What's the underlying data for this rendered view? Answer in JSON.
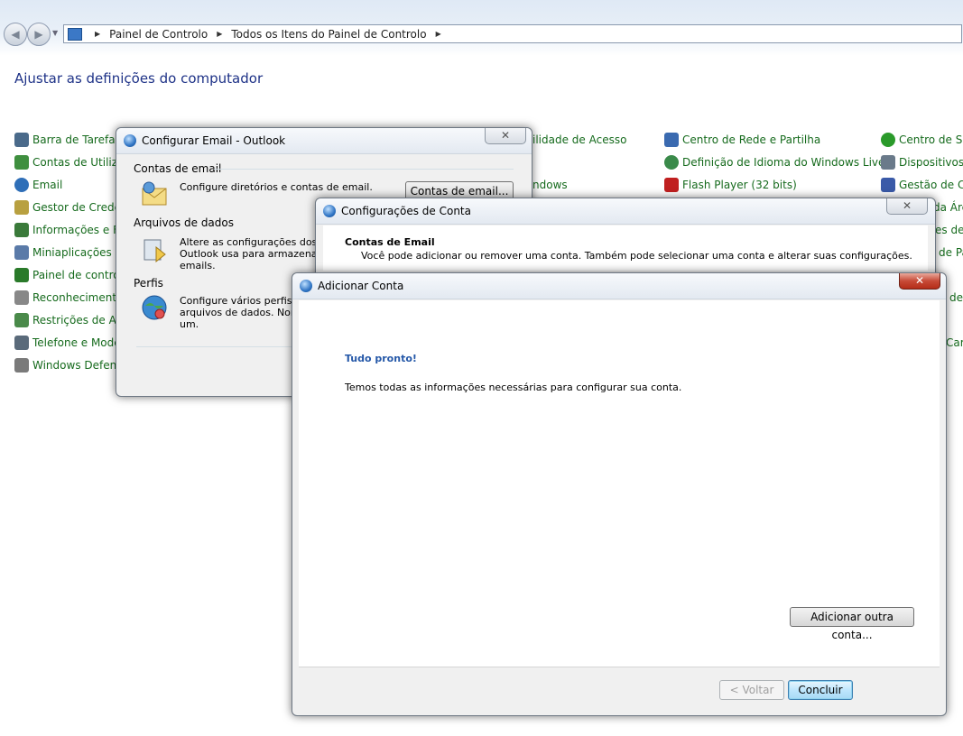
{
  "breadcrumb": [
    "Painel de Controlo",
    "Todos os Itens do Painel de Controlo"
  ],
  "heading": "Ajustar as definições do computador",
  "cp_column1": [
    {
      "label": "Barra de Tarefas e",
      "icon": "taskbar-icon",
      "color": "#4a6a8a"
    },
    {
      "label": "Contas de Utilizad",
      "icon": "users-icon",
      "color": "#3f8f3f"
    },
    {
      "label": "Email",
      "icon": "email-globe-icon",
      "color": "#2f6fb8"
    },
    {
      "label": "Gestor de Creden",
      "icon": "credential-icon",
      "color": "#b8a040"
    },
    {
      "label": "Informações e Fer",
      "icon": "performance-icon",
      "color": "#3a7a3a"
    },
    {
      "label": "Miniaplicações de",
      "icon": "gadgets-icon",
      "color": "#5a7aa8"
    },
    {
      "label": "Painel de controlo",
      "icon": "java-icon",
      "color": "#2a7a2a"
    },
    {
      "label": "Reconhecimento",
      "icon": "microphone-icon",
      "color": "#888888"
    },
    {
      "label": "Restrições de Ace",
      "icon": "parental-icon",
      "color": "#4a8a4a"
    },
    {
      "label": "Telefone e Moder",
      "icon": "phone-icon",
      "color": "#5a6a7a"
    },
    {
      "label": "Windows Defende",
      "icon": "defender-icon",
      "color": "#7a7a7a"
    }
  ],
  "cp_column2": [
    {
      "label": "ilidade de Acesso"
    },
    {
      "label": "ndows"
    }
  ],
  "cp_column3": [
    {
      "label": "Centro de Rede e Partilha",
      "icon": "network-icon",
      "color": "#3a6ab0"
    },
    {
      "label": "Definição de Idioma do Windows Live",
      "icon": "globe-icon",
      "color": "#3a8a4a"
    },
    {
      "label": "Flash Player (32 bits)",
      "icon": "flash-icon",
      "color": "#c02020"
    }
  ],
  "cp_column4": [
    {
      "label": "Centro de Sin",
      "icon": "sync-icon",
      "color": "#2a9a2a"
    },
    {
      "label": "Dispositivos e",
      "icon": "devices-icon",
      "color": "#6a7a8a"
    },
    {
      "label": "Gestão de Co",
      "icon": "color-icon",
      "color": "#3a5aa8"
    },
    {
      "label": "da Áre"
    },
    {
      "label": "es de P"
    },
    {
      "label": "de Pa"
    },
    {
      "label": "de"
    },
    {
      "label": "Car"
    }
  ],
  "outlook_dialog": {
    "title": "Configurar Email - Outlook",
    "email_section": "Contas de email",
    "email_text": "Configure diretórios e contas de email.",
    "email_button": "Contas de email...",
    "data_section": "Arquivos de dados",
    "data_text": [
      "Altere as configurações dos a",
      "Outlook usa para armazenar",
      "emails."
    ],
    "profiles_section": "Perfis",
    "profiles_text": [
      "Configure vários perfis d",
      "arquivos de dados. Norm",
      "um."
    ]
  },
  "account_settings": {
    "title": "Configurações de Conta",
    "header": "Contas de Email",
    "description": "Você pode adicionar ou remover uma conta. Também pode selecionar uma conta e alterar suas configurações."
  },
  "add_account": {
    "title": "Adicionar Conta",
    "ready": "Tudo pronto!",
    "message": "Temos todas as informações necessárias para configurar sua conta.",
    "add_another": "Adicionar outra conta...",
    "back": "< Voltar",
    "finish": "Concluir",
    "ready_color": "#2558a8"
  }
}
